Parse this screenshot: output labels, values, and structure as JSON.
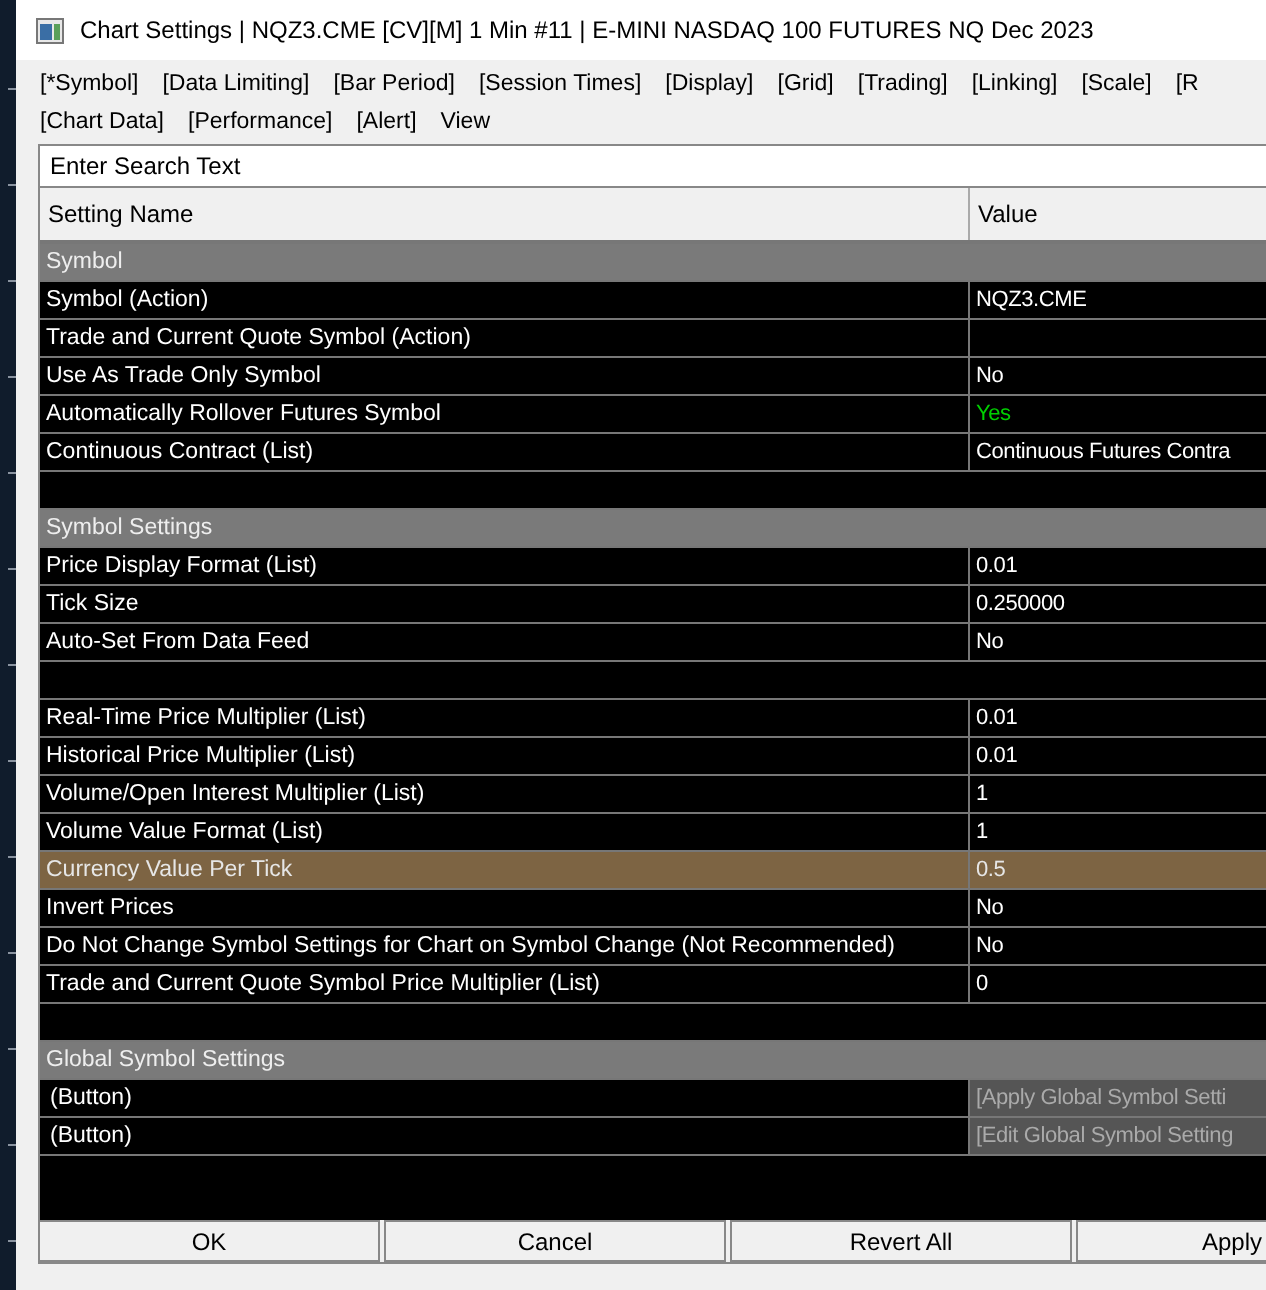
{
  "window": {
    "title": "Chart Settings | NQZ3.CME [CV][M]  1 Min  #11 | E-MINI NASDAQ 100 FUTURES NQ Dec 2023"
  },
  "tabs": [
    [
      "[*Symbol]",
      "[Data Limiting]",
      "[Bar Period]",
      "[Session Times]",
      "[Display]",
      "[Grid]",
      "[Trading]",
      "[Linking]",
      "[Scale]",
      "[R"
    ],
    [
      "[Chart Data]",
      "[Performance]",
      "[Alert]",
      "View"
    ]
  ],
  "search": {
    "placeholder": "Enter Search Text"
  },
  "table": {
    "columns": [
      "Setting Name",
      "Value"
    ],
    "rows": [
      {
        "kind": "group",
        "name": "Symbol"
      },
      {
        "kind": "setting",
        "name": "Symbol (Action)",
        "value": "NQZ3.CME",
        "selected": false
      },
      {
        "kind": "setting",
        "name": "Trade and Current Quote Symbol (Action)",
        "selected": false
      },
      {
        "kind": "setting",
        "name": "Use As Trade Only Symbol",
        "value": "No",
        "selected": false
      },
      {
        "kind": "setting",
        "name": "Automatically Rollover Futures Symbol",
        "value": "Yes",
        "positive": true,
        "selected": false
      },
      {
        "kind": "setting",
        "name": "Continuous Contract (List)",
        "value": "Continuous Futures Contra",
        "selected": false
      },
      {
        "kind": "blank"
      },
      {
        "kind": "group",
        "name": "Symbol Settings"
      },
      {
        "kind": "setting",
        "name": "Price Display Format (List)",
        "value": "0.01",
        "selected": false
      },
      {
        "kind": "setting",
        "name": "Tick Size",
        "value": "0.250000",
        "selected": false
      },
      {
        "kind": "setting",
        "name": "Auto-Set From Data Feed",
        "value": "No",
        "selected": false
      },
      {
        "kind": "blank"
      },
      {
        "kind": "setting",
        "name": "Real-Time Price Multiplier (List)",
        "value": "0.01",
        "selected": false
      },
      {
        "kind": "setting",
        "name": "Historical Price Multiplier (List)",
        "value": "0.01",
        "selected": false
      },
      {
        "kind": "setting",
        "name": "Volume/Open Interest Multiplier (List)",
        "value": "1",
        "selected": false
      },
      {
        "kind": "setting",
        "name": "Volume Value Format (List)",
        "value": "1",
        "selected": false
      },
      {
        "kind": "setting",
        "name": "Currency Value Per Tick",
        "value": "0.5",
        "selected": true
      },
      {
        "kind": "setting",
        "name": "Invert Prices",
        "value": "No",
        "selected": false
      },
      {
        "kind": "setting",
        "name": "Do Not Change Symbol Settings for Chart on Symbol Change (Not Recommended)",
        "value": "No",
        "selected": false
      },
      {
        "kind": "setting",
        "name": "Trade and Current Quote Symbol Price Multiplier (List)",
        "value": "0",
        "selected": false
      },
      {
        "kind": "blank"
      },
      {
        "kind": "group",
        "name": "Global Symbol Settings"
      },
      {
        "kind": "button",
        "name": "(Button)",
        "value": "[Apply Global Symbol Setti"
      },
      {
        "kind": "button",
        "name": "(Button)",
        "value": "[Edit Global Symbol Setting"
      }
    ]
  },
  "buttons": [
    "OK",
    "Cancel",
    "Revert All",
    "Apply"
  ]
}
